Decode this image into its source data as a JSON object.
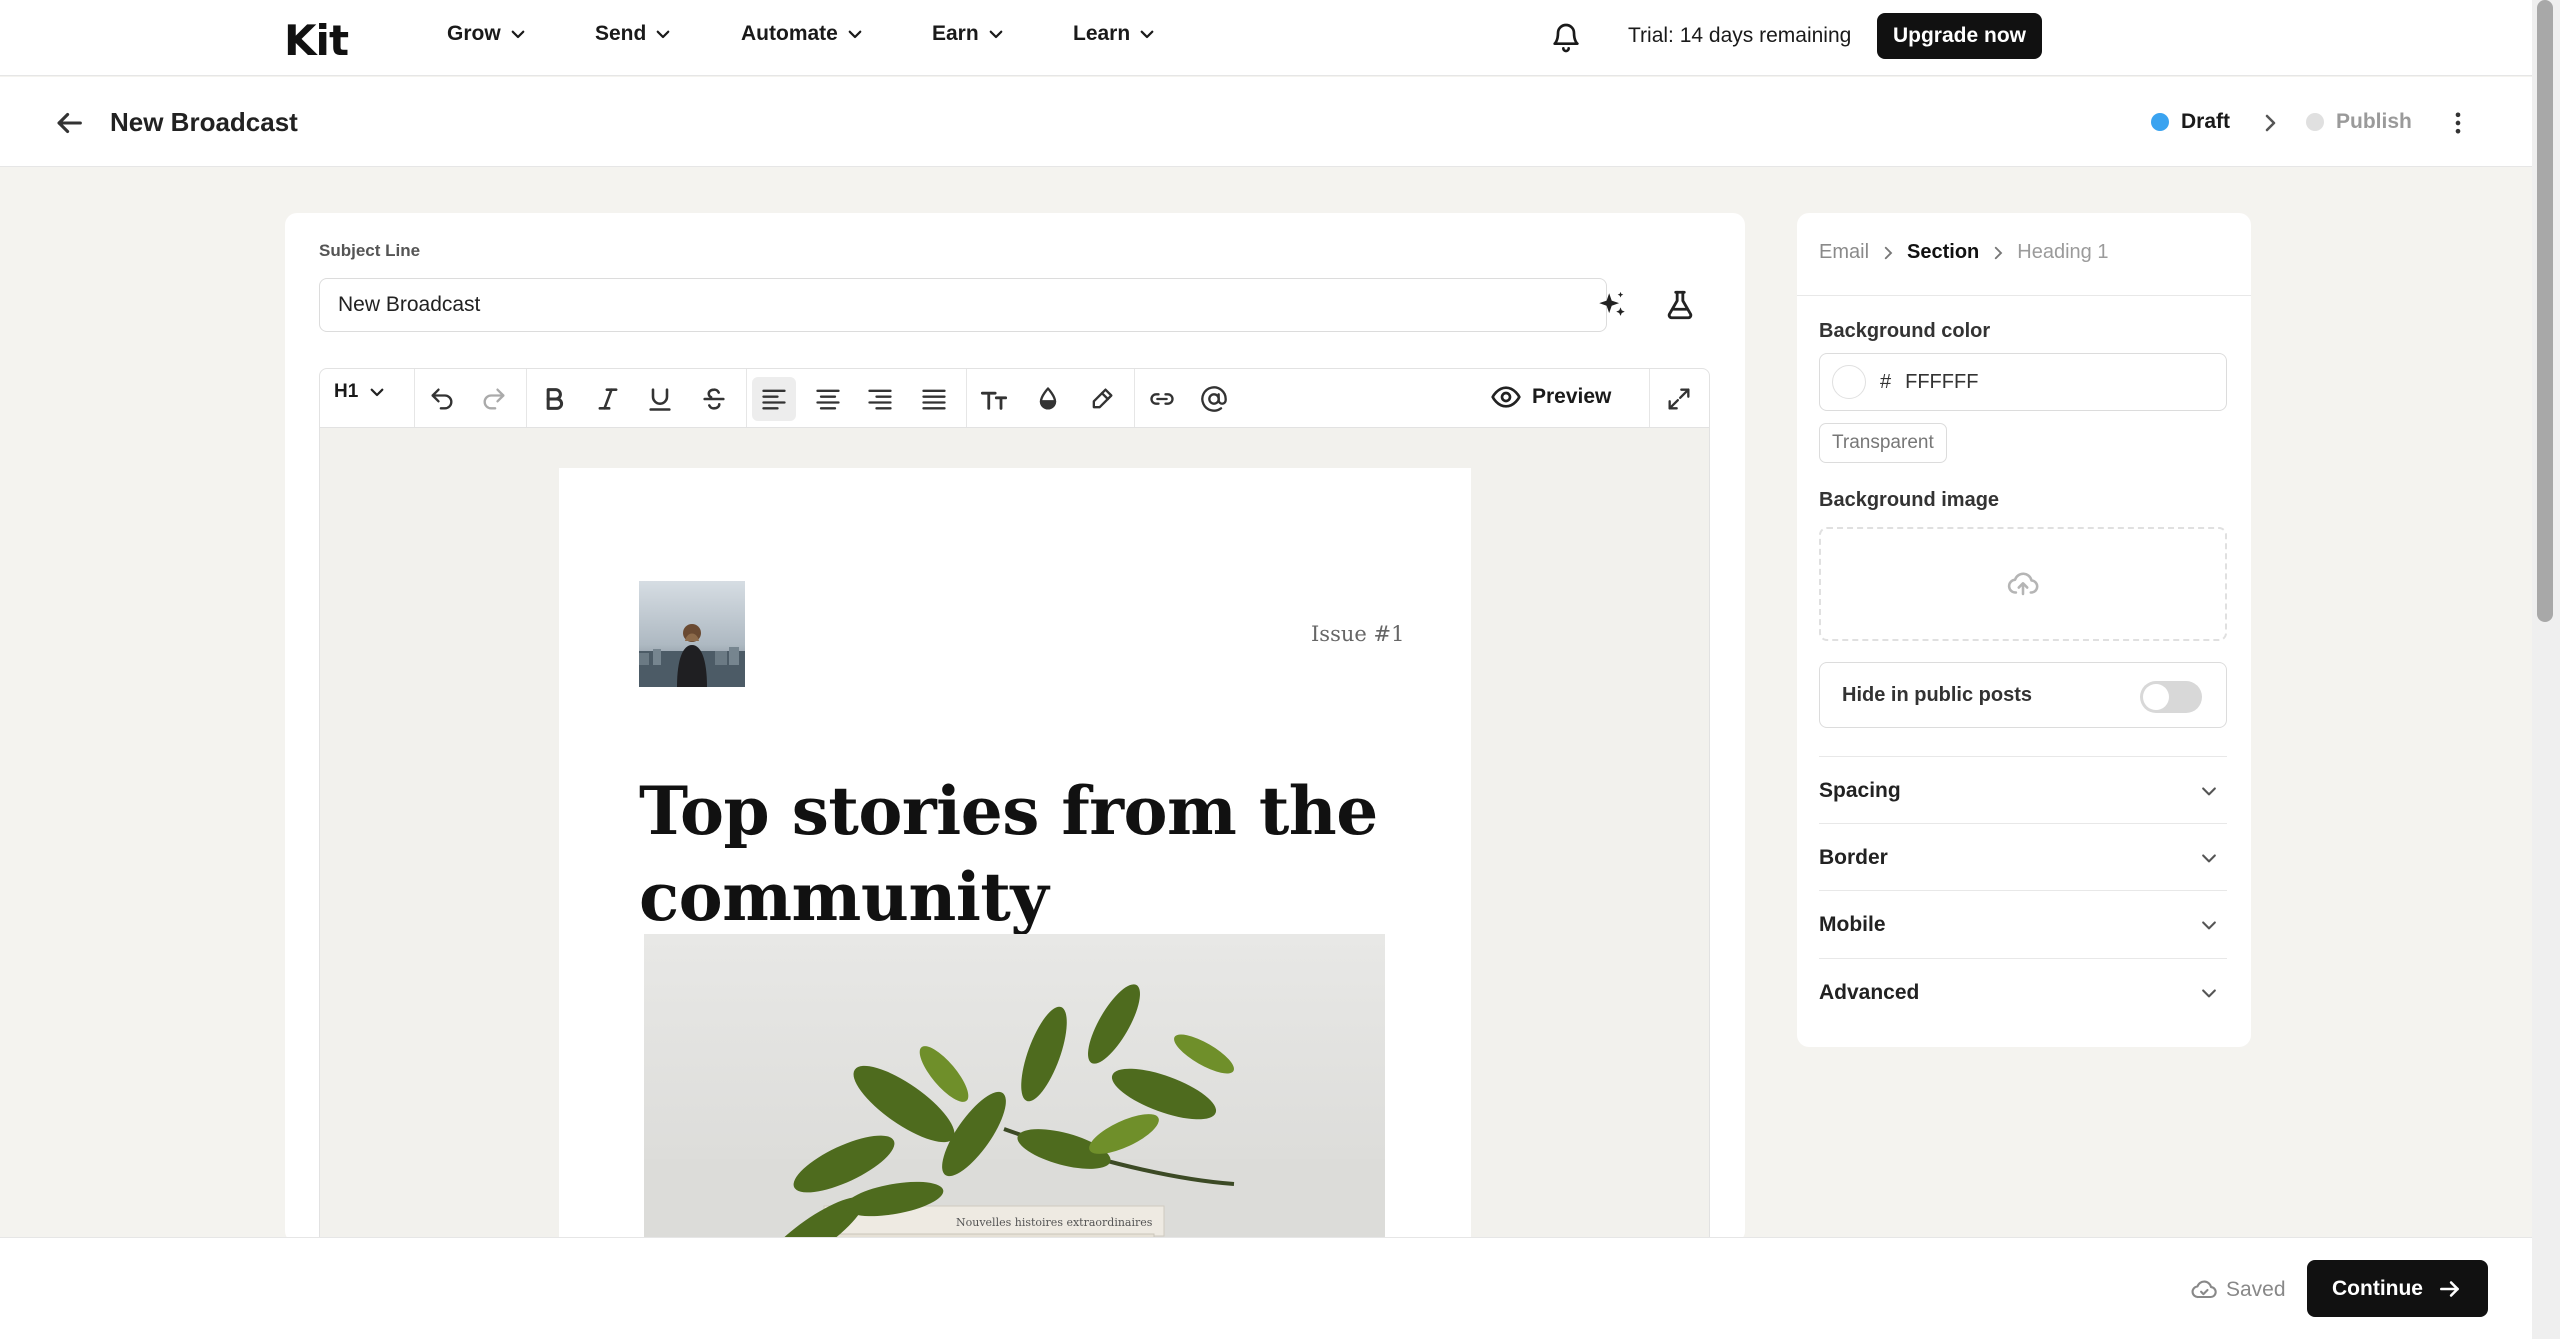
{
  "brand": {
    "logo_text": "Kit"
  },
  "topnav": {
    "items": [
      {
        "label": "Grow"
      },
      {
        "label": "Send"
      },
      {
        "label": "Automate"
      },
      {
        "label": "Earn"
      },
      {
        "label": "Learn"
      }
    ],
    "trial_text": "Trial: 14 days remaining",
    "upgrade_label": "Upgrade now"
  },
  "header": {
    "title": "New Broadcast",
    "status_draft": "Draft",
    "status_publish": "Publish",
    "colors": {
      "draft_dot": "#3aa3f0",
      "publish_dot": "#e0e0e0"
    }
  },
  "editor": {
    "subject_label": "Subject Line",
    "subject_value": "New Broadcast",
    "heading_select": "H1",
    "preview_label": "Preview",
    "issue_text": "Issue #1",
    "headline": "Top stories from the community",
    "hero_book_text": "Nouvelles histoires extraordinaires"
  },
  "panel": {
    "breadcrumb": {
      "email": "Email",
      "section": "Section",
      "heading": "Heading 1"
    },
    "bg_color_label": "Background color",
    "hash": "#",
    "bg_color_value": "FFFFFF",
    "transparent_label": "Transparent",
    "bg_image_label": "Background image",
    "hide_public_label": "Hide in public posts",
    "hide_public_on": false,
    "sections": [
      "Spacing",
      "Border",
      "Mobile",
      "Advanced"
    ]
  },
  "footer": {
    "saved_label": "Saved",
    "continue_label": "Continue"
  }
}
